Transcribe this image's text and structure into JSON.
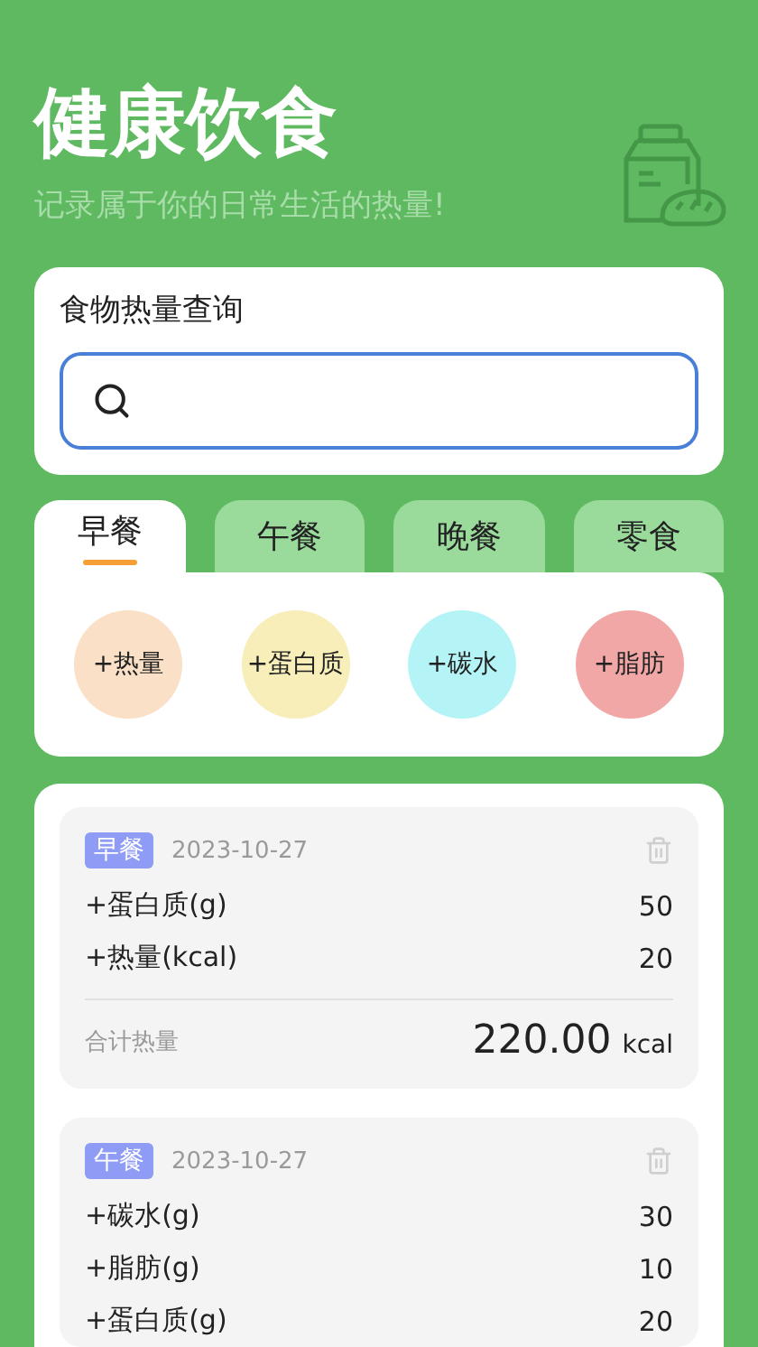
{
  "header": {
    "title": "健康饮食",
    "subtitle": "记录属于你的日常生活的热量!"
  },
  "search": {
    "title": "食物热量查询"
  },
  "tabs": [
    {
      "label": "早餐",
      "selected": true
    },
    {
      "label": "午餐",
      "selected": false
    },
    {
      "label": "晚餐",
      "selected": false
    },
    {
      "label": "零食",
      "selected": false
    }
  ],
  "add_buttons": [
    {
      "label": "+热量",
      "color": "#f9e0c6"
    },
    {
      "label": "+蛋白质",
      "color": "#f7eeb9"
    },
    {
      "label": "+碳水",
      "color": "#b4f3f6"
    },
    {
      "label": "+脂肪",
      "color": "#f1a7a6"
    }
  ],
  "records": [
    {
      "meal": "早餐",
      "date": "2023-10-27",
      "items": [
        {
          "name": "+蛋白质(g)",
          "value": "50"
        },
        {
          "name": "+热量(kcal)",
          "value": "20"
        }
      ],
      "total_label": "合计热量",
      "total": "220.00",
      "unit": "kcal"
    },
    {
      "meal": "午餐",
      "date": "2023-10-27",
      "items": [
        {
          "name": "+碳水(g)",
          "value": "30"
        },
        {
          "name": "+脂肪(g)",
          "value": "10"
        },
        {
          "name": "+蛋白质(g)",
          "value": "20"
        }
      ]
    }
  ]
}
